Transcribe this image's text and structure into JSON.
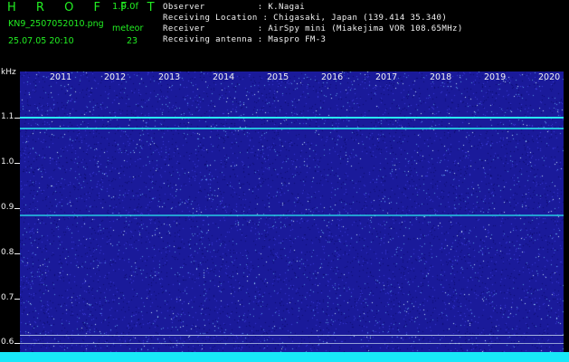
{
  "header": {
    "logo": "H R O F F T",
    "version": "1.0.0f",
    "filename": "KN9_2507052010.png",
    "meteor_label": "meteor",
    "datetime": "25.07.05 20:10",
    "meteor_count": "23",
    "observer_line": "Observer          : K.Nagai",
    "location_line": "Receiving Location : Chigasaki, Japan (139.414 35.340)",
    "receiver_line": "Receiver          : AirSpy mini (Miakejima VOR 108.65MHz)",
    "antenna_line": "Receiving antenna : Maspro FM-3"
  },
  "axis": {
    "unit": "kHz",
    "y_labels": [
      "1.1",
      "1.0",
      "0.9",
      "0.8",
      "0.7",
      "0.6"
    ],
    "x_labels": [
      "2011",
      "2012",
      "2013",
      "2014",
      "2015",
      "2016",
      "2017",
      "2018",
      "2019",
      "2020"
    ]
  },
  "colors": {
    "background": "#1a1a9a",
    "signal": "#28e8f0",
    "text": "#f2f2f2",
    "header_text": "#22ee22"
  }
}
